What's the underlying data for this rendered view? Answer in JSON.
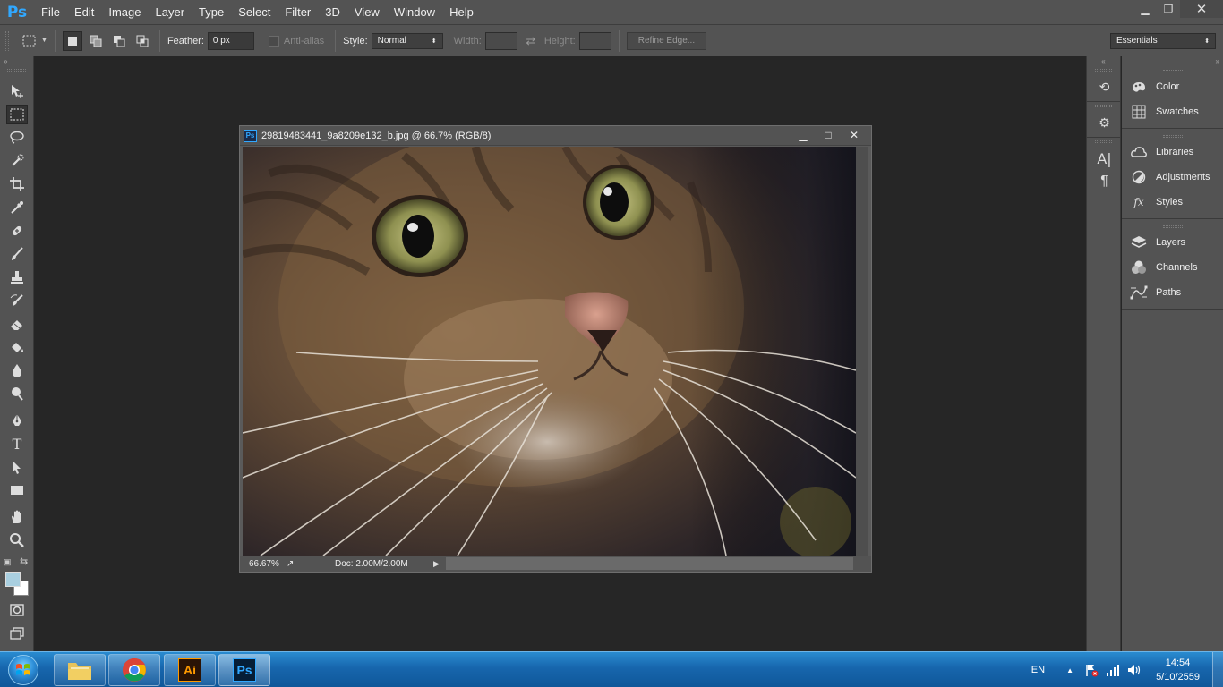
{
  "menubar": {
    "logo": "Ps",
    "items": [
      "File",
      "Edit",
      "Image",
      "Layer",
      "Type",
      "Select",
      "Filter",
      "3D",
      "View",
      "Window",
      "Help"
    ]
  },
  "options_bar": {
    "feather_label": "Feather:",
    "feather_value": "0 px",
    "antialias_label": "Anti-alias",
    "style_label": "Style:",
    "style_value": "Normal",
    "width_label": "Width:",
    "height_label": "Height:",
    "refine_edge_label": "Refine Edge...",
    "workspace_value": "Essentials"
  },
  "document": {
    "badge": "Ps",
    "title": "29819483441_9a8209e132_b.jpg @ 66.7% (RGB/8)",
    "zoom": "66.67%",
    "doc_info": "Doc: 2.00M/2.00M"
  },
  "panels": {
    "group1": [
      {
        "label": "Color",
        "icon": "color-icon"
      },
      {
        "label": "Swatches",
        "icon": "swatches-icon"
      }
    ],
    "group2": [
      {
        "label": "Libraries",
        "icon": "libraries-icon"
      },
      {
        "label": "Adjustments",
        "icon": "adjustments-icon"
      },
      {
        "label": "Styles",
        "icon": "styles-icon"
      }
    ],
    "group3": [
      {
        "label": "Layers",
        "icon": "layers-icon"
      },
      {
        "label": "Channels",
        "icon": "channels-icon"
      },
      {
        "label": "Paths",
        "icon": "paths-icon"
      }
    ]
  },
  "colors": {
    "foreground": "#a9cfe0",
    "background": "#ffffff",
    "ps_blue": "#31a8ff"
  },
  "taskbar": {
    "apps": [
      "file-explorer",
      "chrome",
      "illustrator",
      "photoshop"
    ],
    "illustrator_label": "Ai",
    "photoshop_label": "Ps",
    "language": "EN",
    "time": "14:54",
    "date": "5/10/2559"
  }
}
